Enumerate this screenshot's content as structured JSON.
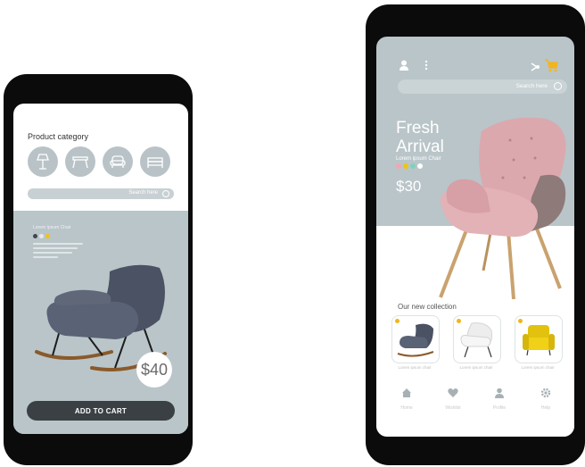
{
  "left_phone": {
    "category_title": "Product category",
    "categories": [
      {
        "icon": "floor-lamp-icon"
      },
      {
        "icon": "table-icon"
      },
      {
        "icon": "armchair-icon"
      },
      {
        "icon": "bed-icon"
      }
    ],
    "search_placeholder": "Search here",
    "product_name": "Lorem Ipsum Chair",
    "price": "$40",
    "add_to_cart_label": "ADD TO CART",
    "colors": {
      "screen_bg": "#b9c5c9",
      "button": "#3a4044",
      "swatches": [
        "#3f4651",
        "#e8e8e8",
        "#f1c40f"
      ]
    }
  },
  "right_phone": {
    "search_placeholder": "Search here",
    "hero_title_line1": "Fresh",
    "hero_title_line2": "Arrival",
    "hero_subtitle": "Lorem ipsum Chair",
    "price": "$30",
    "swatches": [
      "#f0a7b3",
      "#f1c40f",
      "#7fd1c0",
      "#ffffff"
    ],
    "collection_title": "Our new collection",
    "collection": [
      {
        "label": "Lorem ipsum chair",
        "icon": "dark-rocking-chair-icon"
      },
      {
        "label": "Lorem ipsum chair",
        "icon": "white-chair-icon"
      },
      {
        "label": "Lorem ipsum chair",
        "icon": "yellow-armchair-icon"
      }
    ],
    "nav": [
      {
        "label": "Home",
        "icon": "home-icon"
      },
      {
        "label": "Wishlist",
        "icon": "heart-icon"
      },
      {
        "label": "Profile",
        "icon": "user-icon"
      },
      {
        "label": "Help",
        "icon": "gear-icon"
      }
    ]
  }
}
